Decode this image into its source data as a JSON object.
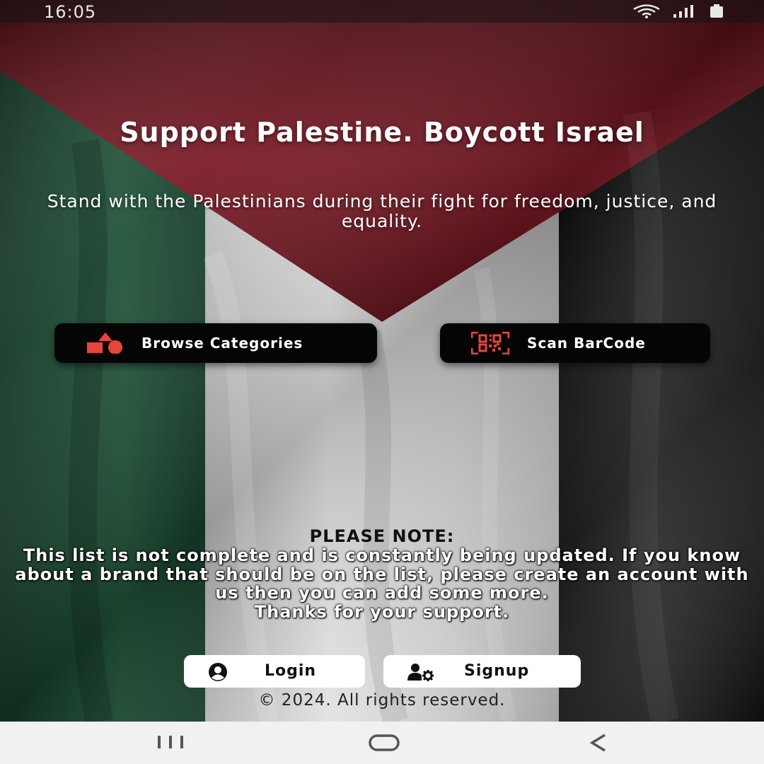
{
  "status_bar": {
    "time": "16:05",
    "icons": [
      "wifi-icon",
      "signal-icon",
      "battery-icon"
    ]
  },
  "hero": {
    "title": "Support Palestine. Boycott Israel",
    "subtitle": "Stand with the Palestinians during their fight for freedom, justice, and equality."
  },
  "actions": {
    "browse_label": "Browse Categories",
    "browse_icon": "shapes-icon",
    "scan_label": "Scan BarCode",
    "scan_icon": "qr-code-icon"
  },
  "note": {
    "title": "PLEASE NOTE:",
    "body": "This list is not complete and is constantly being updated. If you know about a brand that should be on the list, please create an account with us then you can add some more.",
    "thanks": "Thanks for your support."
  },
  "auth": {
    "login_label": "Login",
    "login_icon": "user-circle-icon",
    "signup_label": "Signup",
    "signup_icon": "user-gear-icon"
  },
  "footer": {
    "copyright": "© 2024. All rights reserved."
  },
  "colors": {
    "accent_red": "#e8453c",
    "flag_red": "#6e1420",
    "flag_green": "#1d4a34",
    "flag_white": "#d9d9d9",
    "flag_black": "#151515"
  }
}
